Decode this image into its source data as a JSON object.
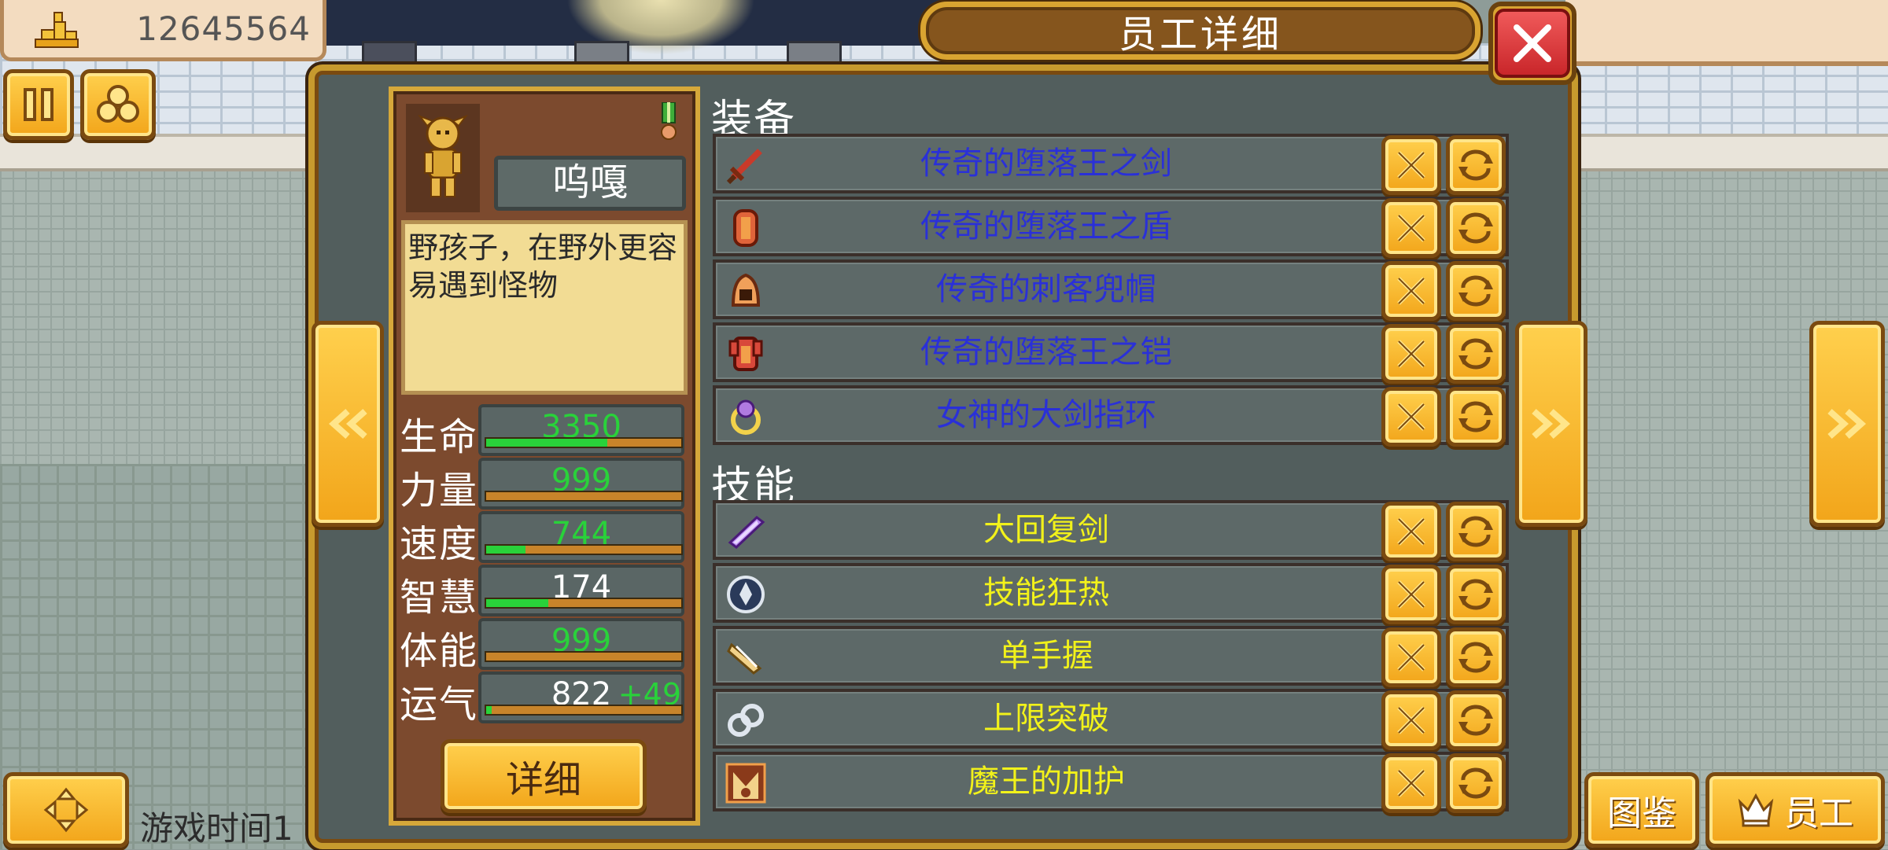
{
  "hud": {
    "money": "12645564",
    "game_time": "游戏时间1",
    "catalog_label": "图鉴",
    "staff_label": "员工"
  },
  "dialog": {
    "title": "员工详细"
  },
  "character": {
    "name": "呜嘎",
    "description": "野孩子，在野外更容易遇到怪物",
    "detail_button": "详细",
    "stats": [
      {
        "label": "生命",
        "value": "3350",
        "value_color": "#29d23a",
        "bonus": "",
        "fill": 0.62
      },
      {
        "label": "力量",
        "value": "999",
        "value_color": "#29d23a",
        "bonus": "",
        "fill": 0.0
      },
      {
        "label": "速度",
        "value": "744",
        "value_color": "#29d23a",
        "bonus": "",
        "fill": 0.2
      },
      {
        "label": "智慧",
        "value": "174",
        "value_color": "#ffffff",
        "bonus": "",
        "fill": 0.32
      },
      {
        "label": "体能",
        "value": "999",
        "value_color": "#29d23a",
        "bonus": "",
        "fill": 0.0
      },
      {
        "label": "运气",
        "value": "822",
        "value_color": "#ffffff",
        "bonus": "+49",
        "fill": 0.03
      }
    ]
  },
  "equipment": {
    "title": "装备",
    "items": [
      {
        "label": "传奇的堕落王之剑",
        "icon": "sword-icon"
      },
      {
        "label": "传奇的堕落王之盾",
        "icon": "shield-icon"
      },
      {
        "label": "传奇的刺客兜帽",
        "icon": "hood-icon"
      },
      {
        "label": "传奇的堕落王之铠",
        "icon": "armor-icon"
      },
      {
        "label": "女神的大剑指环",
        "icon": "ring-icon"
      }
    ]
  },
  "skills": {
    "title": "技能",
    "items": [
      {
        "label": "大回复剑",
        "icon": "crystal-sword-icon"
      },
      {
        "label": "技能狂热",
        "icon": "fist-icon"
      },
      {
        "label": "单手握",
        "icon": "glove-icon"
      },
      {
        "label": "上限突破",
        "icon": "chain-icon"
      },
      {
        "label": "魔王的加护",
        "icon": "demon-king-icon"
      }
    ]
  },
  "colors": {
    "equipment_text": "#2a30d8",
    "skill_text": "#f2f21a",
    "gold": "#f2b83a",
    "dialog_bg": "#525e5d"
  }
}
